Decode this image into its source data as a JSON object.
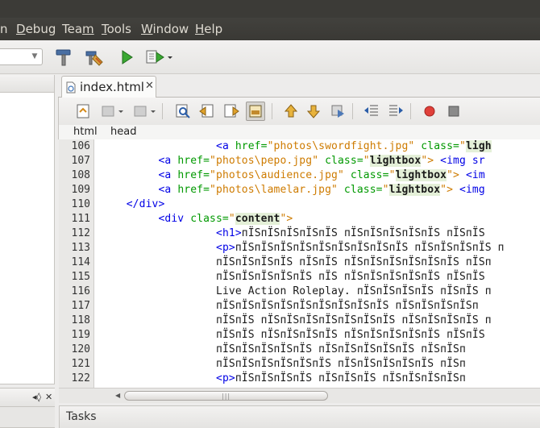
{
  "menubar": {
    "items": [
      {
        "pre": "",
        "acc": "",
        "post": "n"
      },
      {
        "pre": "",
        "acc": "D",
        "post": "ebug"
      },
      {
        "pre": "Tea",
        "acc": "m",
        "post": ""
      },
      {
        "pre": "",
        "acc": "T",
        "post": "ools"
      },
      {
        "pre": "",
        "acc": "W",
        "post": "indow"
      },
      {
        "pre": "",
        "acc": "H",
        "post": "elp"
      }
    ]
  },
  "editor": {
    "tab_label": "index.html",
    "tab_close": "✕",
    "breadcrumb": [
      "html",
      "head"
    ]
  },
  "code": {
    "line_numbers": [
      "106",
      "107",
      "108",
      "109",
      "110",
      "111",
      "112",
      "113",
      "114",
      "115",
      "116",
      "117",
      "118",
      "119",
      "120",
      "121",
      "122"
    ],
    "lines": [
      [
        {
          "t": "                   ",
          "c": "t-text"
        },
        {
          "t": "<a ",
          "c": "t-tag"
        },
        {
          "t": "href=",
          "c": "t-attr"
        },
        {
          "t": "\"photos\\swordfight.jpg\"",
          "c": "t-val"
        },
        {
          "t": " class=",
          "c": "t-attr"
        },
        {
          "t": "\"",
          "c": "t-val"
        },
        {
          "t": "ligh",
          "c": "t-bold"
        }
      ],
      [
        {
          "t": "          ",
          "c": "t-text"
        },
        {
          "t": "<a ",
          "c": "t-tag"
        },
        {
          "t": "href=",
          "c": "t-attr"
        },
        {
          "t": "\"photos\\pepo.jpg\"",
          "c": "t-val"
        },
        {
          "t": " class=",
          "c": "t-attr"
        },
        {
          "t": "\"",
          "c": "t-val"
        },
        {
          "t": "lightbox",
          "c": "t-bold"
        },
        {
          "t": "\">",
          "c": "t-val"
        },
        {
          "t": " <img sr",
          "c": "t-tag"
        }
      ],
      [
        {
          "t": "          ",
          "c": "t-text"
        },
        {
          "t": "<a ",
          "c": "t-tag"
        },
        {
          "t": "href=",
          "c": "t-attr"
        },
        {
          "t": "\"photos\\audience.jpg\"",
          "c": "t-val"
        },
        {
          "t": " class=",
          "c": "t-attr"
        },
        {
          "t": "\"",
          "c": "t-val"
        },
        {
          "t": "lightbox",
          "c": "t-bold"
        },
        {
          "t": "\">",
          "c": "t-val"
        },
        {
          "t": " <im",
          "c": "t-tag"
        }
      ],
      [
        {
          "t": "          ",
          "c": "t-text"
        },
        {
          "t": "<a ",
          "c": "t-tag"
        },
        {
          "t": "href=",
          "c": "t-attr"
        },
        {
          "t": "\"photos\\lamelar.jpg\"",
          "c": "t-val"
        },
        {
          "t": " class=",
          "c": "t-attr"
        },
        {
          "t": "\"",
          "c": "t-val"
        },
        {
          "t": "lightbox",
          "c": "t-bold"
        },
        {
          "t": "\">",
          "c": "t-val"
        },
        {
          "t": " <img",
          "c": "t-tag"
        }
      ],
      [
        {
          "t": "     ",
          "c": "t-text"
        },
        {
          "t": "</div>",
          "c": "t-tag"
        }
      ],
      [
        {
          "t": "          ",
          "c": "t-text"
        },
        {
          "t": "<div ",
          "c": "t-tag"
        },
        {
          "t": "class=",
          "c": "t-attr"
        },
        {
          "t": "\"",
          "c": "t-val"
        },
        {
          "t": "content",
          "c": "t-bold"
        },
        {
          "t": "\">",
          "c": "t-val"
        }
      ],
      [
        {
          "t": "                   ",
          "c": "t-text"
        },
        {
          "t": "<h1>",
          "c": "t-tag"
        },
        {
          "t": "пЇЅпЇЅпЇЅпЇЅпЇЅ пЇЅпЇЅпЇЅпЇЅпЇЅ пЇЅпЇЅ",
          "c": "t-text"
        }
      ],
      [
        {
          "t": "                   ",
          "c": "t-text"
        },
        {
          "t": "<p>",
          "c": "t-tag"
        },
        {
          "t": "пЇЅпЇЅпЇЅпЇЅпЇЅпЇЅпЇЅпЇЅпЇЅ пЇЅпЇЅпЇЅпЇЅ п",
          "c": "t-text"
        }
      ],
      [
        {
          "t": "                   ",
          "c": "t-text"
        },
        {
          "t": "пЇЅпЇЅпЇЅпЇЅ пЇЅпЇЅ пЇЅпЇЅпЇЅпЇЅпЇЅпЇЅ пЇЅп",
          "c": "t-text"
        }
      ],
      [
        {
          "t": "                   ",
          "c": "t-text"
        },
        {
          "t": "пЇЅпЇЅпЇЅпЇЅпЇЅ пЇЅ пЇЅпЇЅпЇЅпЇЅпЇЅ пЇЅпЇЅ",
          "c": "t-text"
        }
      ],
      [
        {
          "t": "                   ",
          "c": "t-text"
        },
        {
          "t": "Live Action Roleplay. пЇЅпЇЅпЇЅпЇЅ пЇЅпЇЅ п",
          "c": "t-text"
        }
      ],
      [
        {
          "t": "                   ",
          "c": "t-text"
        },
        {
          "t": "пЇЅпЇЅпЇЅпЇЅпЇЅпЇЅпЇЅпЇЅпЇЅ пЇЅпЇЅпЇЅпЇЅп",
          "c": "t-text"
        }
      ],
      [
        {
          "t": "                   ",
          "c": "t-text"
        },
        {
          "t": "пЇЅпЇЅ пЇЅпЇЅпЇЅпЇЅпЇЅпЇЅпЇЅ пЇЅпЇЅпЇЅпЇЅ п",
          "c": "t-text"
        }
      ],
      [
        {
          "t": "                   ",
          "c": "t-text"
        },
        {
          "t": "пЇЅпЇЅ пЇЅпЇЅпЇЅпЇЅ пЇЅпЇЅпЇЅпЇЅпЇЅ пЇЅпЇЅ",
          "c": "t-text"
        }
      ],
      [
        {
          "t": "                   ",
          "c": "t-text"
        },
        {
          "t": "пЇЅпЇЅпЇЅпЇЅпЇЅ пЇЅпЇЅпЇЅпЇЅпЇЅ пЇЅпЇЅп",
          "c": "t-text"
        }
      ],
      [
        {
          "t": "                   ",
          "c": "t-text"
        },
        {
          "t": "пЇЅпЇЅпЇЅпЇЅпЇЅпЇЅ пЇЅпЇЅпЇЅпЇЅпЇЅ пЇЅп",
          "c": "t-text"
        }
      ],
      [
        {
          "t": "                   ",
          "c": "t-text"
        },
        {
          "t": "<p>",
          "c": "t-tag"
        },
        {
          "t": "пЇЅпЇЅпЇЅпЇЅ пЇЅпЇЅпЇЅ пЇЅпЇЅпЇЅпЇЅп",
          "c": "t-text"
        }
      ]
    ]
  },
  "scrollbar": {
    "left_arrow": "◀",
    "grip": "|||"
  },
  "tasks": {
    "label": "Tasks"
  },
  "left_panel": {
    "pin_icon": "◂◊",
    "close": "✕"
  }
}
